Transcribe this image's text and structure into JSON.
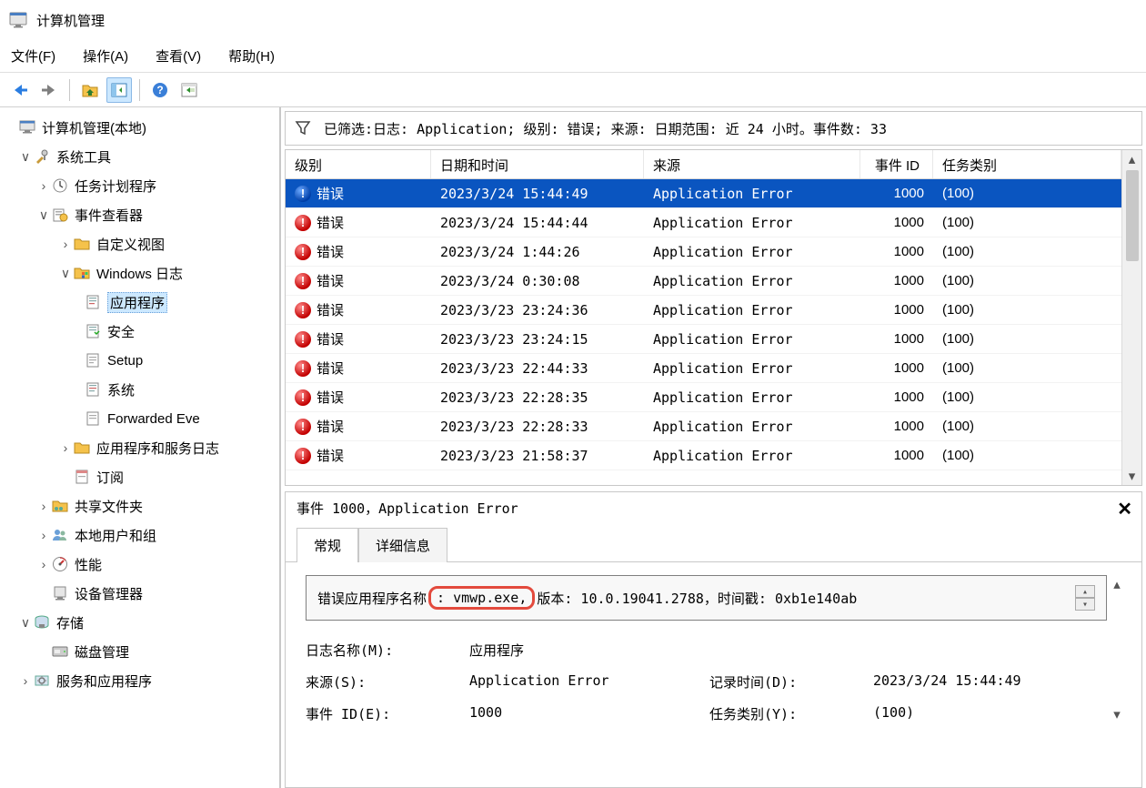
{
  "window": {
    "title": "计算机管理"
  },
  "menu": {
    "file": "文件(F)",
    "action": "操作(A)",
    "view": "查看(V)",
    "help": "帮助(H)"
  },
  "tree": {
    "root": "计算机管理(本地)",
    "system_tools": "系统工具",
    "task_scheduler": "任务计划程序",
    "event_viewer": "事件查看器",
    "custom_views": "自定义视图",
    "windows_logs": "Windows 日志",
    "log_app": "应用程序",
    "log_security": "安全",
    "log_setup": "Setup",
    "log_system": "系统",
    "log_forwarded": "Forwarded Eve",
    "app_service_logs": "应用程序和服务日志",
    "subscriptions": "订阅",
    "shared_folders": "共享文件夹",
    "local_users": "本地用户和组",
    "performance": "性能",
    "device_manager": "设备管理器",
    "storage": "存储",
    "disk_mgmt": "磁盘管理",
    "services_apps": "服务和应用程序"
  },
  "filter": {
    "text": "已筛选:日志: Application; 级别: 错误; 来源: 日期范围: 近 24 小时。事件数: 33"
  },
  "table": {
    "headers": {
      "level": "级别",
      "datetime": "日期和时间",
      "source": "来源",
      "event_id": "事件 ID",
      "category": "任务类别"
    },
    "rows": [
      {
        "level": "错误",
        "datetime": "2023/3/24 15:44:49",
        "source": "Application Error",
        "event_id": "1000",
        "category": "(100)",
        "selected": true
      },
      {
        "level": "错误",
        "datetime": "2023/3/24 15:44:44",
        "source": "Application Error",
        "event_id": "1000",
        "category": "(100)"
      },
      {
        "level": "错误",
        "datetime": "2023/3/24 1:44:26",
        "source": "Application Error",
        "event_id": "1000",
        "category": "(100)"
      },
      {
        "level": "错误",
        "datetime": "2023/3/24 0:30:08",
        "source": "Application Error",
        "event_id": "1000",
        "category": "(100)"
      },
      {
        "level": "错误",
        "datetime": "2023/3/23 23:24:36",
        "source": "Application Error",
        "event_id": "1000",
        "category": "(100)"
      },
      {
        "level": "错误",
        "datetime": "2023/3/23 23:24:15",
        "source": "Application Error",
        "event_id": "1000",
        "category": "(100)"
      },
      {
        "level": "错误",
        "datetime": "2023/3/23 22:44:33",
        "source": "Application Error",
        "event_id": "1000",
        "category": "(100)"
      },
      {
        "level": "错误",
        "datetime": "2023/3/23 22:28:35",
        "source": "Application Error",
        "event_id": "1000",
        "category": "(100)"
      },
      {
        "level": "错误",
        "datetime": "2023/3/23 22:28:33",
        "source": "Application Error",
        "event_id": "1000",
        "category": "(100)"
      },
      {
        "level": "错误",
        "datetime": "2023/3/23 21:58:37",
        "source": "Application Error",
        "event_id": "1000",
        "category": "(100)"
      }
    ]
  },
  "detail": {
    "header": "事件 1000，Application Error",
    "tab_general": "常规",
    "tab_details": "详细信息",
    "fault_prefix": "错误应用程序名称",
    "fault_exe": ": vmwp.exe,",
    "fault_suffix": " 版本: 10.0.19041.2788，时间戳: 0xb1e140ab",
    "labels": {
      "log_name": "日志名称(M):",
      "source": "来源(S):",
      "event_id": "事件 ID(E):",
      "logged": "记录时间(D):",
      "category": "任务类别(Y):"
    },
    "values": {
      "log_name": "应用程序",
      "source": "Application Error",
      "event_id": "1000",
      "logged": "2023/3/24 15:44:49",
      "category": "(100)"
    }
  }
}
